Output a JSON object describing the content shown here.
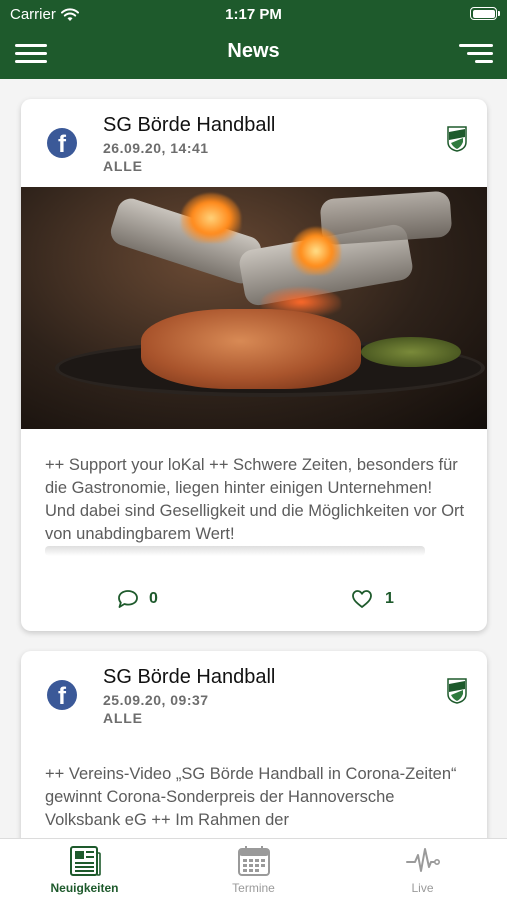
{
  "status_bar": {
    "carrier": "Carrier",
    "time": "1:17 PM"
  },
  "navbar": {
    "title": "News",
    "menu_icon": "hamburger-menu-icon",
    "filter_icon": "filter-icon"
  },
  "posts": [
    {
      "source_icon": "facebook-icon",
      "page_name": "SG Börde Handball",
      "date": "26.09.20, 14:41",
      "category": "ALLE",
      "image": "roast-meat-in-pan-over-fire",
      "text": "++ Support your loKal ++ Schwere Zeiten, besonders für die Gastronomie, liegen hinter einigen Unternehmen! Und dabei sind Geselligkeit und die Möglichkeiten vor Ort von unabdingbarem Wert!",
      "comments": "0",
      "likes": "1"
    },
    {
      "source_icon": "facebook-icon",
      "page_name": "SG Börde Handball",
      "date": "25.09.20, 09:37",
      "category": "ALLE",
      "text": "++ Vereins-Video „SG Börde Handball in Corona-Zeiten“ gewinnt Corona-Sonderpreis der Hannoversche Volksbank eG ++ Im Rahmen der"
    }
  ],
  "tabs": [
    {
      "label": "Neuigkeiten",
      "icon": "newspaper-icon",
      "active": true
    },
    {
      "label": "Termine",
      "icon": "calendar-icon",
      "active": false
    },
    {
      "label": "Live",
      "icon": "pulse-icon",
      "active": false
    }
  ],
  "colors": {
    "primary": "#1e5a2c",
    "facebook": "#3b5998",
    "inactive_tab": "#9a9a9a"
  }
}
